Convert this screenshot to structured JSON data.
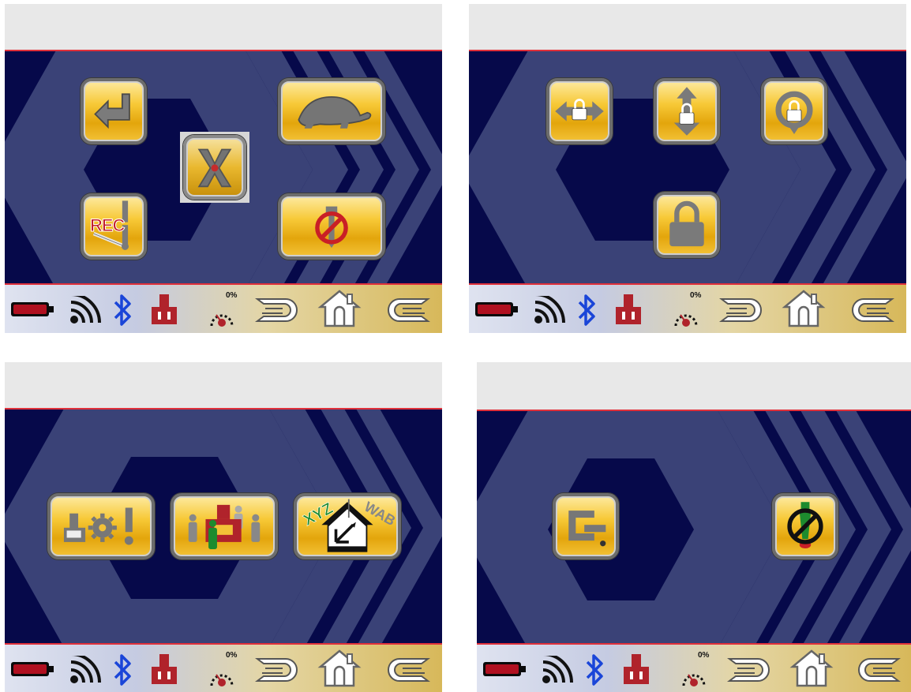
{
  "screens": [
    {
      "name": "operation-menu",
      "buttons": [
        "return",
        "slow-speed",
        "cancel-axis",
        "record",
        "disable-tool"
      ],
      "selected": "cancel-axis"
    },
    {
      "name": "lock-menu",
      "buttons": [
        "lock-horizontal",
        "lock-vertical",
        "lock-rotation",
        "lock-all"
      ]
    },
    {
      "name": "settings-menu",
      "buttons": [
        "machine-settings",
        "operator-positions",
        "coordinate-system"
      ],
      "coordinate_labels": {
        "xyz": "XYZ",
        "wab": "WAB"
      }
    },
    {
      "name": "clamp-menu",
      "buttons": [
        "clamp",
        "disable-spindle"
      ]
    }
  ],
  "status_bar": {
    "percent": "0%",
    "icons": [
      "battery-icon",
      "wireless-signal-icon",
      "bluetooth-icon",
      "machine-icon",
      "speed-gauge-icon",
      "menu-right-icon",
      "home-icon",
      "menu-left-icon"
    ]
  },
  "record_label": "REC",
  "colors": {
    "background_dark": "#06094a",
    "chevron": "#3a4277",
    "button_gold": "#f7c937",
    "accent_red": "#e0303a",
    "bluetooth_blue": "#1a45d8",
    "machine_red": "#b0232b"
  }
}
